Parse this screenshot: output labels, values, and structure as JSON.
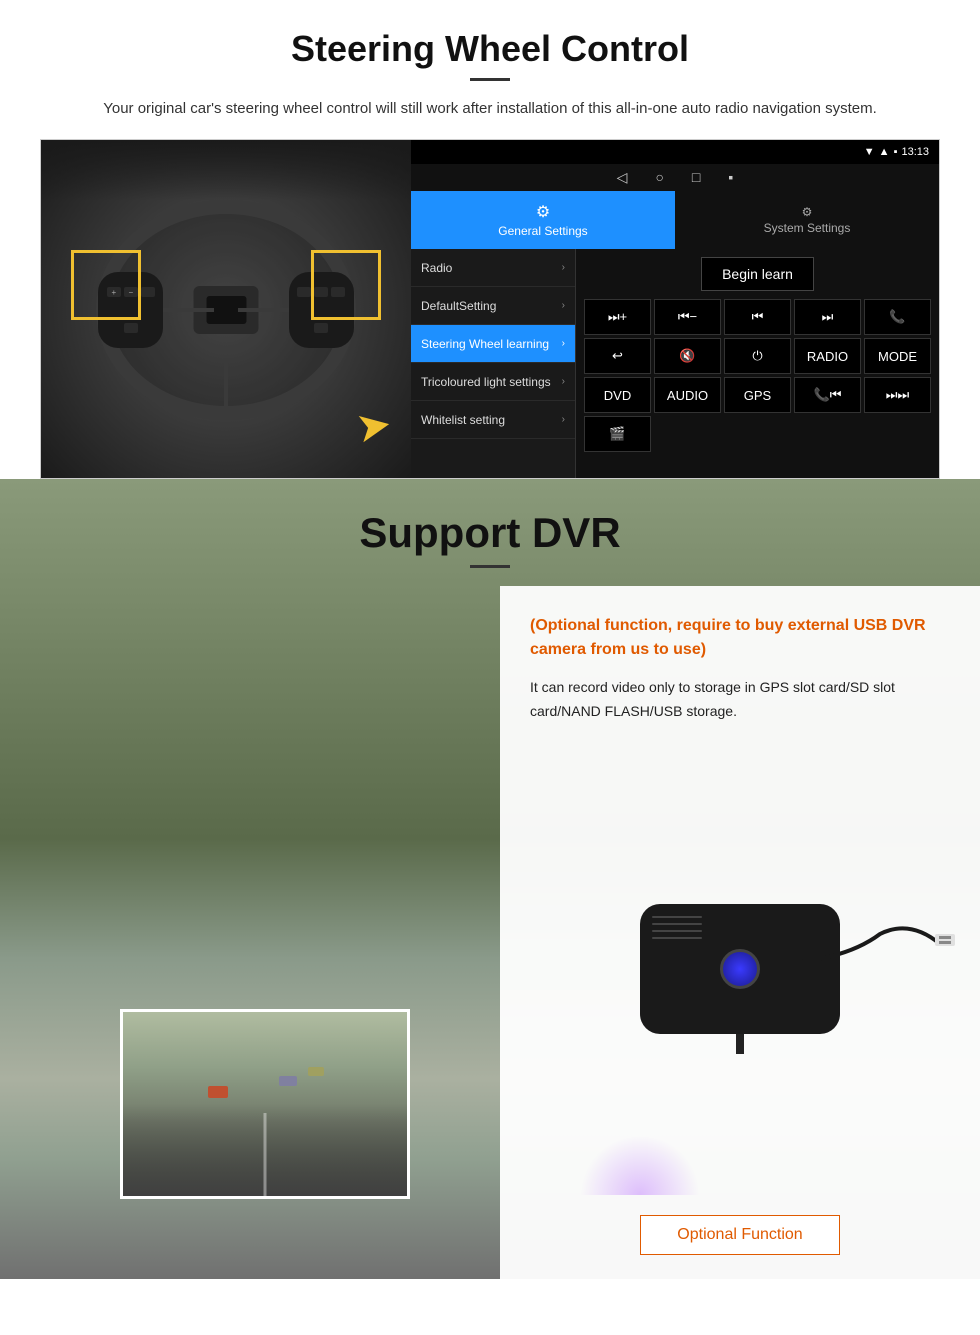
{
  "steering": {
    "title": "Steering Wheel Control",
    "description": "Your original car's steering wheel control will still work after installation of this all-in-one auto radio navigation system.",
    "android_ui": {
      "status_bar": {
        "time": "13:13",
        "wifi": "▼",
        "signal": "▲",
        "battery": "⬛"
      },
      "nav_bar": {
        "back": "◁",
        "home": "○",
        "recent": "□",
        "menu": "⬛"
      },
      "tab_general": "General Settings",
      "tab_system": "System Settings",
      "menu_items": [
        {
          "label": "Radio",
          "active": false
        },
        {
          "label": "DefaultSetting",
          "active": false
        },
        {
          "label": "Steering Wheel learning",
          "active": true
        },
        {
          "label": "Tricoloured light settings",
          "active": false
        },
        {
          "label": "Whitelist setting",
          "active": false
        }
      ],
      "begin_learn": "Begin learn",
      "control_buttons": [
        "⏭+",
        "⏮−",
        "⏮⏮",
        "⏭⏭",
        "📞",
        "↩",
        "🔇×",
        "⏻",
        "RADIO",
        "MODE",
        "DVD",
        "AUDIO",
        "GPS",
        "📞⏮",
        "⏭⏭",
        "🎬"
      ]
    }
  },
  "dvr": {
    "title": "Support DVR",
    "optional_text": "(Optional function, require to buy external USB DVR camera from us to use)",
    "description": "It can record video only to storage in GPS slot card/SD slot card/NAND FLASH/USB storage.",
    "optional_button": "Optional Function"
  }
}
